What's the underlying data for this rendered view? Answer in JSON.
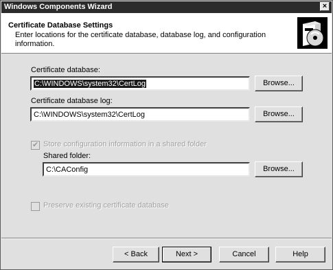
{
  "window": {
    "title": "Windows Components Wizard",
    "close_glyph": "×"
  },
  "header": {
    "title": "Certificate Database Settings",
    "description": "Enter locations for the certificate database, database log, and configuration information."
  },
  "cert_db": {
    "label": "Certificate database:",
    "value": "C:\\WINDOWS\\system32\\CertLog",
    "browse": "Browse..."
  },
  "cert_log": {
    "label": "Certificate database log:",
    "value": "C:\\WINDOWS\\system32\\CertLog",
    "browse": "Browse..."
  },
  "shared": {
    "checkbox_label": "Store configuration information in a shared folder",
    "checked": true,
    "folder_label": "Shared folder:",
    "value": "C:\\CAConfig",
    "browse": "Browse..."
  },
  "preserve": {
    "checkbox_label": "Preserve existing certificate database",
    "checked": false
  },
  "footer": {
    "back": "< Back",
    "next": "Next >",
    "cancel": "Cancel",
    "help": "Help"
  },
  "colors": {
    "titlebar": "#2b2b2b",
    "face": "#e0e0e0",
    "selection": "#1c1c1c"
  },
  "icons": {
    "header": "software-box-cd-icon",
    "checkbox": "checkmark-icon"
  }
}
